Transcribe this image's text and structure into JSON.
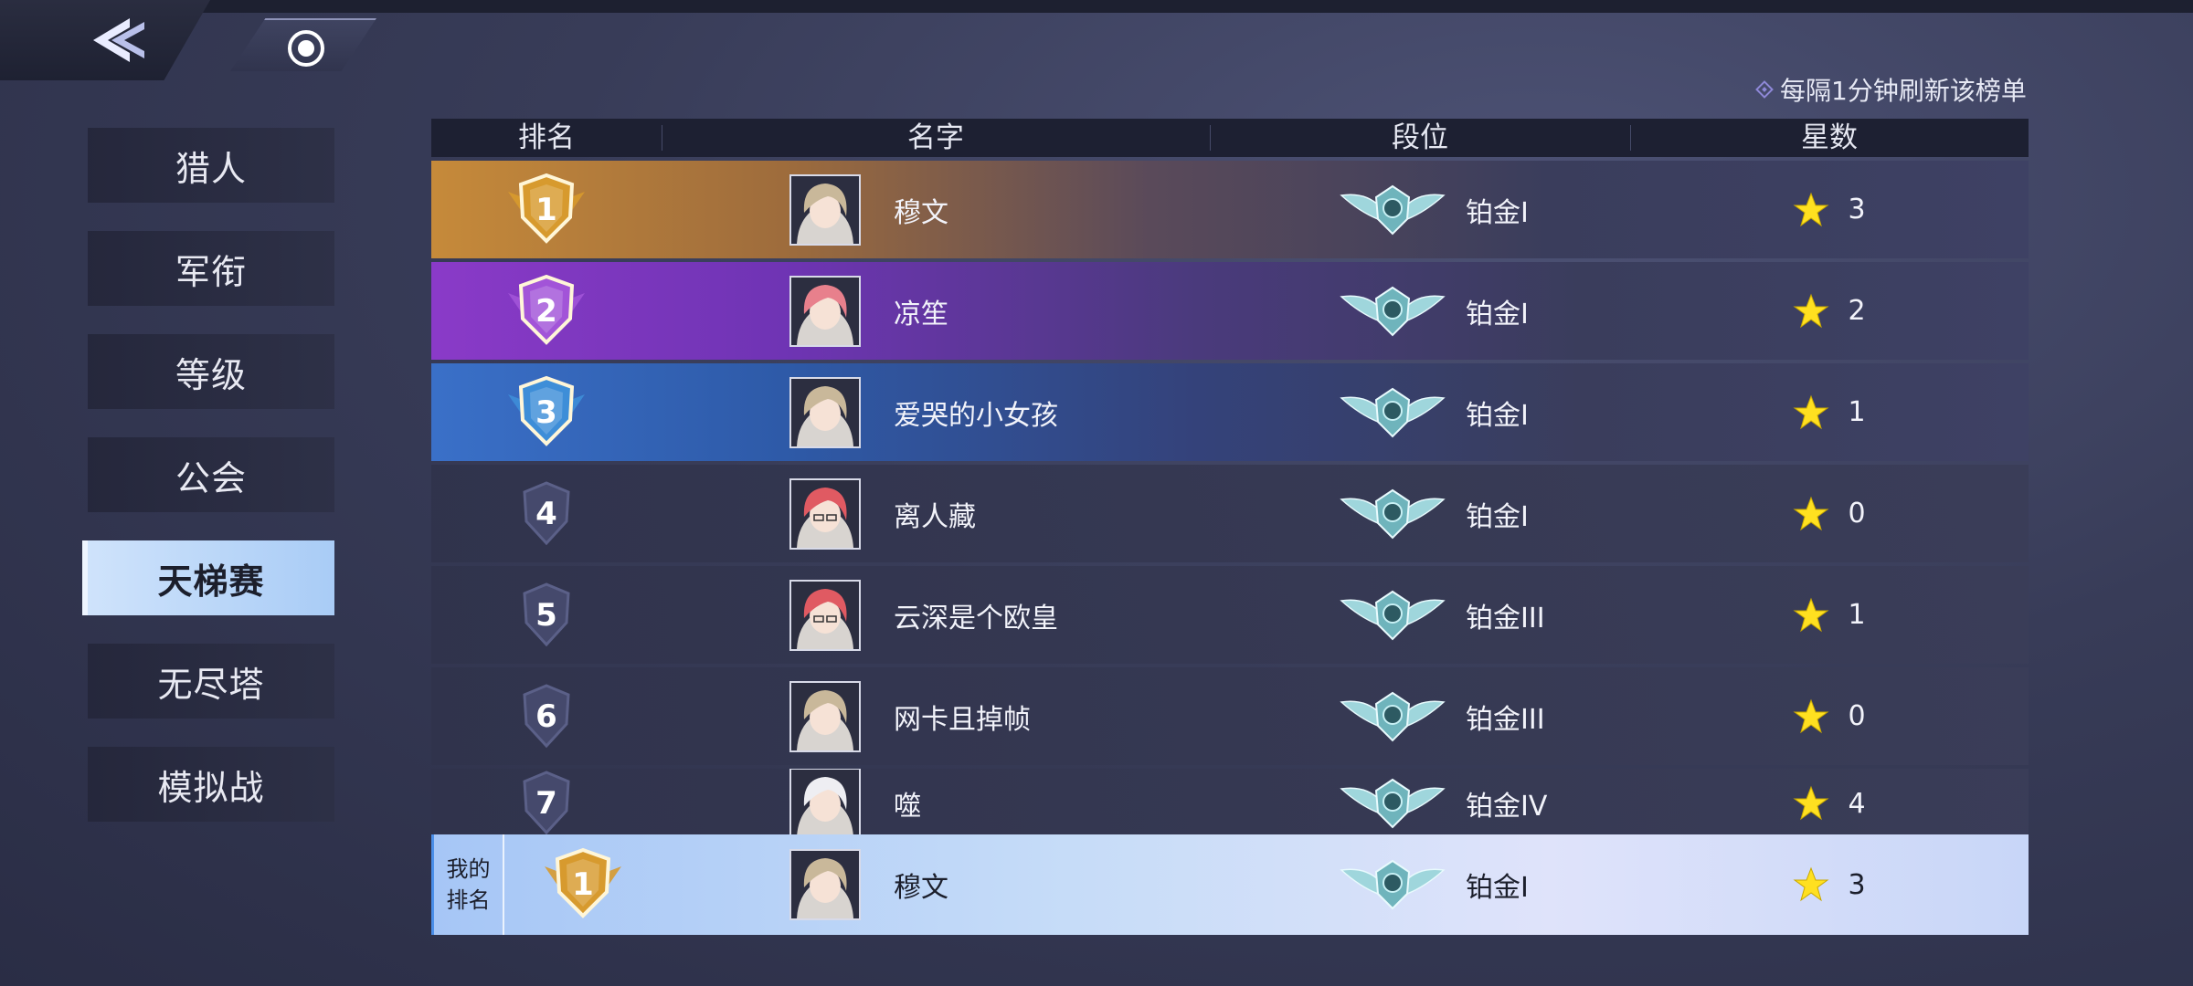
{
  "nav": {
    "back_icon": "back-double-chevron-icon",
    "target_icon": "target-dot-icon"
  },
  "refresh_note": "每隔1分钟刷新该榜单",
  "sidebar": {
    "items": [
      {
        "label": "猎人",
        "active": false
      },
      {
        "label": "军衔",
        "active": false
      },
      {
        "label": "等级",
        "active": false
      },
      {
        "label": "公会",
        "active": false
      },
      {
        "label": "天梯赛",
        "active": true
      },
      {
        "label": "无尽塔",
        "active": false
      },
      {
        "label": "模拟战",
        "active": false
      }
    ]
  },
  "table": {
    "headers": {
      "rank": "排名",
      "name": "名字",
      "tier": "段位",
      "stars": "星数"
    },
    "rows": [
      {
        "rank": "1",
        "name": "穆文",
        "tier": "铂金I",
        "stars": "3",
        "avatar": "blonde-hunter"
      },
      {
        "rank": "2",
        "name": "凉笙",
        "tier": "铂金I",
        "stars": "2",
        "avatar": "pink-hair-girl"
      },
      {
        "rank": "3",
        "name": "爱哭的小女孩",
        "tier": "铂金I",
        "stars": "1",
        "avatar": "blonde-hunter"
      },
      {
        "rank": "4",
        "name": "离人藏",
        "tier": "铂金I",
        "stars": "0",
        "avatar": "red-hair-glasses"
      },
      {
        "rank": "5",
        "name": "云深是个欧皇",
        "tier": "铂金III",
        "stars": "1",
        "avatar": "red-hair-glasses"
      },
      {
        "rank": "6",
        "name": "网卡且掉帧",
        "tier": "铂金III",
        "stars": "0",
        "avatar": "blonde-hunter"
      },
      {
        "rank": "7",
        "name": "噬",
        "tier": "铂金IV",
        "stars": "4",
        "avatar": "white-hair"
      }
    ],
    "my_rank": {
      "label_line1": "我的",
      "label_line2": "排名",
      "rank": "1",
      "name": "穆文",
      "tier": "铂金I",
      "stars": "3",
      "avatar": "blonde-hunter"
    }
  },
  "colors": {
    "gold": "#d79a2e",
    "purple": "#a254d8",
    "blue": "#3e8ed8",
    "star": "#ffe020",
    "active_tab": "#bcd8f8"
  }
}
